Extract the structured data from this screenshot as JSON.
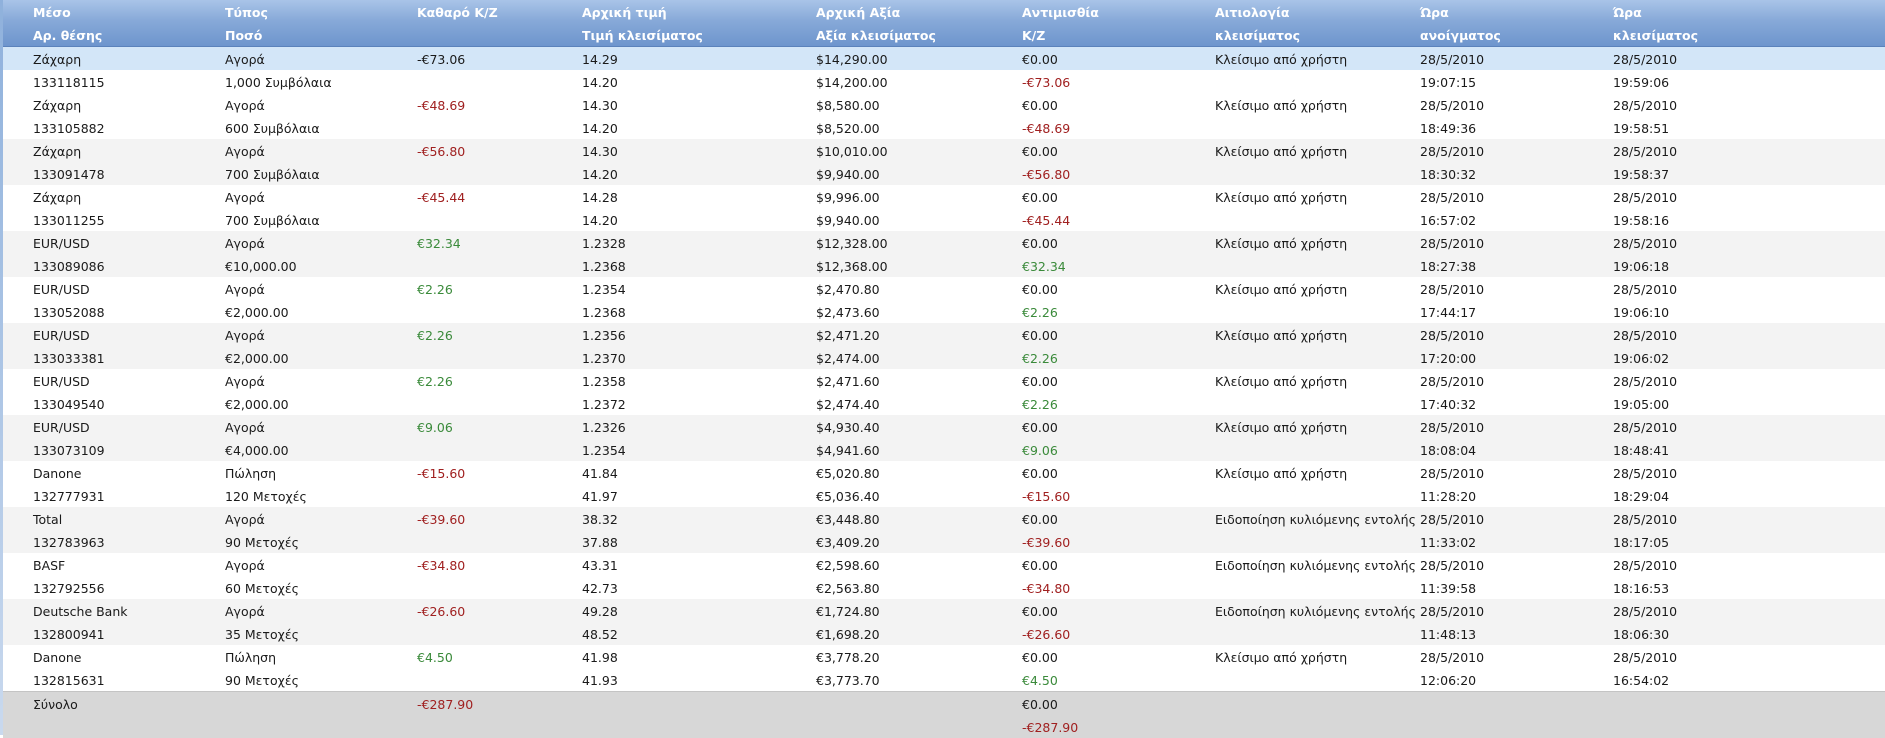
{
  "header": {
    "line1": [
      "Μέσο",
      "Τύπος",
      "Καθαρό Κ/Ζ",
      "Αρχική τιμή",
      "Αρχική Αξία",
      "Αντιμισθία",
      "Αιτιολογία",
      "Ώρα",
      "Ώρα"
    ],
    "line2": [
      "Αρ. θέσης",
      "Ποσό",
      "",
      "Τιμή κλεισίματος",
      "Αξία κλεισίματος",
      "Κ/Ζ",
      "κλεισίματος",
      "ανοίγματος",
      "κλεισίματος"
    ]
  },
  "rows": [
    {
      "instrument": "Ζάχαρη",
      "position_id": "133118115",
      "type": "Αγορά",
      "amount": "1,000 Συμβόλαια",
      "net_pl": "-€73.06",
      "net_sign": "black",
      "open_price": "14.29",
      "close_price": "14.20",
      "open_value": "$14,290.00",
      "close_value": "$14,200.00",
      "commission": "€0.00",
      "pl": "-€73.06",
      "pl_sign": "neg",
      "reason": "Κλείσιμο από χρήστη",
      "open_date": "28/5/2010",
      "open_time": "19:07:15",
      "close_date": "28/5/2010",
      "close_time": "19:59:06",
      "selected": true
    },
    {
      "instrument": "Ζάχαρη",
      "position_id": "133105882",
      "type": "Αγορά",
      "amount": "600 Συμβόλαια",
      "net_pl": "-€48.69",
      "net_sign": "neg",
      "open_price": "14.30",
      "close_price": "14.20",
      "open_value": "$8,580.00",
      "close_value": "$8,520.00",
      "commission": "€0.00",
      "pl": "-€48.69",
      "pl_sign": "neg",
      "reason": "Κλείσιμο από χρήστη",
      "open_date": "28/5/2010",
      "open_time": "18:49:36",
      "close_date": "28/5/2010",
      "close_time": "19:58:51"
    },
    {
      "instrument": "Ζάχαρη",
      "position_id": "133091478",
      "type": "Αγορά",
      "amount": "700 Συμβόλαια",
      "net_pl": "-€56.80",
      "net_sign": "neg",
      "open_price": "14.30",
      "close_price": "14.20",
      "open_value": "$10,010.00",
      "close_value": "$9,940.00",
      "commission": "€0.00",
      "pl": "-€56.80",
      "pl_sign": "neg",
      "reason": "Κλείσιμο από χρήστη",
      "open_date": "28/5/2010",
      "open_time": "18:30:32",
      "close_date": "28/5/2010",
      "close_time": "19:58:37"
    },
    {
      "instrument": "Ζάχαρη",
      "position_id": "133011255",
      "type": "Αγορά",
      "amount": "700 Συμβόλαια",
      "net_pl": "-€45.44",
      "net_sign": "neg",
      "open_price": "14.28",
      "close_price": "14.20",
      "open_value": "$9,996.00",
      "close_value": "$9,940.00",
      "commission": "€0.00",
      "pl": "-€45.44",
      "pl_sign": "neg",
      "reason": "Κλείσιμο από χρήστη",
      "open_date": "28/5/2010",
      "open_time": "16:57:02",
      "close_date": "28/5/2010",
      "close_time": "19:58:16"
    },
    {
      "instrument": "EUR/USD",
      "position_id": "133089086",
      "type": "Αγορά",
      "amount": "€10,000.00",
      "net_pl": "€32.34",
      "net_sign": "pos",
      "open_price": "1.2328",
      "close_price": "1.2368",
      "open_value": "$12,328.00",
      "close_value": "$12,368.00",
      "commission": "€0.00",
      "pl": "€32.34",
      "pl_sign": "pos",
      "reason": "Κλείσιμο από χρήστη",
      "open_date": "28/5/2010",
      "open_time": "18:27:38",
      "close_date": "28/5/2010",
      "close_time": "19:06:18"
    },
    {
      "instrument": "EUR/USD",
      "position_id": "133052088",
      "type": "Αγορά",
      "amount": "€2,000.00",
      "net_pl": "€2.26",
      "net_sign": "pos",
      "open_price": "1.2354",
      "close_price": "1.2368",
      "open_value": "$2,470.80",
      "close_value": "$2,473.60",
      "commission": "€0.00",
      "pl": "€2.26",
      "pl_sign": "pos",
      "reason": "Κλείσιμο από χρήστη",
      "open_date": "28/5/2010",
      "open_time": "17:44:17",
      "close_date": "28/5/2010",
      "close_time": "19:06:10"
    },
    {
      "instrument": "EUR/USD",
      "position_id": "133033381",
      "type": "Αγορά",
      "amount": "€2,000.00",
      "net_pl": "€2.26",
      "net_sign": "pos",
      "open_price": "1.2356",
      "close_price": "1.2370",
      "open_value": "$2,471.20",
      "close_value": "$2,474.00",
      "commission": "€0.00",
      "pl": "€2.26",
      "pl_sign": "pos",
      "reason": "Κλείσιμο από χρήστη",
      "open_date": "28/5/2010",
      "open_time": "17:20:00",
      "close_date": "28/5/2010",
      "close_time": "19:06:02"
    },
    {
      "instrument": "EUR/USD",
      "position_id": "133049540",
      "type": "Αγορά",
      "amount": "€2,000.00",
      "net_pl": "€2.26",
      "net_sign": "pos",
      "open_price": "1.2358",
      "close_price": "1.2372",
      "open_value": "$2,471.60",
      "close_value": "$2,474.40",
      "commission": "€0.00",
      "pl": "€2.26",
      "pl_sign": "pos",
      "reason": "Κλείσιμο από χρήστη",
      "open_date": "28/5/2010",
      "open_time": "17:40:32",
      "close_date": "28/5/2010",
      "close_time": "19:05:00"
    },
    {
      "instrument": "EUR/USD",
      "position_id": "133073109",
      "type": "Αγορά",
      "amount": "€4,000.00",
      "net_pl": "€9.06",
      "net_sign": "pos",
      "open_price": "1.2326",
      "close_price": "1.2354",
      "open_value": "$4,930.40",
      "close_value": "$4,941.60",
      "commission": "€0.00",
      "pl": "€9.06",
      "pl_sign": "pos",
      "reason": "Κλείσιμο από χρήστη",
      "open_date": "28/5/2010",
      "open_time": "18:08:04",
      "close_date": "28/5/2010",
      "close_time": "18:48:41"
    },
    {
      "instrument": "Danone",
      "position_id": "132777931",
      "type": "Πώληση",
      "amount": "120 Μετοχές",
      "net_pl": "-€15.60",
      "net_sign": "neg",
      "open_price": "41.84",
      "close_price": "41.97",
      "open_value": "€5,020.80",
      "close_value": "€5,036.40",
      "commission": "€0.00",
      "pl": "-€15.60",
      "pl_sign": "neg",
      "reason": "Κλείσιμο από χρήστη",
      "open_date": "28/5/2010",
      "open_time": "11:28:20",
      "close_date": "28/5/2010",
      "close_time": "18:29:04"
    },
    {
      "instrument": "Total",
      "position_id": "132783963",
      "type": "Αγορά",
      "amount": "90 Μετοχές",
      "net_pl": "-€39.60",
      "net_sign": "neg",
      "open_price": "38.32",
      "close_price": "37.88",
      "open_value": "€3,448.80",
      "close_value": "€3,409.20",
      "commission": "€0.00",
      "pl": "-€39.60",
      "pl_sign": "neg",
      "reason": "Ειδοποίηση κυλιόμενης εντολής δια",
      "open_date": "28/5/2010",
      "open_time": "11:33:02",
      "close_date": "28/5/2010",
      "close_time": "18:17:05"
    },
    {
      "instrument": "BASF",
      "position_id": "132792556",
      "type": "Αγορά",
      "amount": "60 Μετοχές",
      "net_pl": "-€34.80",
      "net_sign": "neg",
      "open_price": "43.31",
      "close_price": "42.73",
      "open_value": "€2,598.60",
      "close_value": "€2,563.80",
      "commission": "€0.00",
      "pl": "-€34.80",
      "pl_sign": "neg",
      "reason": "Ειδοποίηση κυλιόμενης εντολής δια",
      "open_date": "28/5/2010",
      "open_time": "11:39:58",
      "close_date": "28/5/2010",
      "close_time": "18:16:53"
    },
    {
      "instrument": "Deutsche Bank",
      "position_id": "132800941",
      "type": "Αγορά",
      "amount": "35 Μετοχές",
      "net_pl": "-€26.60",
      "net_sign": "neg",
      "open_price": "49.28",
      "close_price": "48.52",
      "open_value": "€1,724.80",
      "close_value": "€1,698.20",
      "commission": "€0.00",
      "pl": "-€26.60",
      "pl_sign": "neg",
      "reason": "Ειδοποίηση κυλιόμενης εντολής δια",
      "open_date": "28/5/2010",
      "open_time": "11:48:13",
      "close_date": "28/5/2010",
      "close_time": "18:06:30"
    },
    {
      "instrument": "Danone",
      "position_id": "132815631",
      "type": "Πώληση",
      "amount": "90 Μετοχές",
      "net_pl": "€4.50",
      "net_sign": "pos",
      "open_price": "41.98",
      "close_price": "41.93",
      "open_value": "€3,778.20",
      "close_value": "€3,773.70",
      "commission": "€0.00",
      "pl": "€4.50",
      "pl_sign": "pos",
      "reason": "Κλείσιμο από χρήστη",
      "open_date": "28/5/2010",
      "open_time": "12:06:20",
      "close_date": "28/5/2010",
      "close_time": "16:54:02"
    }
  ],
  "total": {
    "label": "Σύνολο",
    "net_pl": "-€287.90",
    "commission": "€0.00",
    "pl": "-€287.90"
  },
  "colors": {
    "negative": "#a02020",
    "positive": "#3a8a3a",
    "header": "#87a9d8",
    "selected": "#d3e6f8"
  }
}
